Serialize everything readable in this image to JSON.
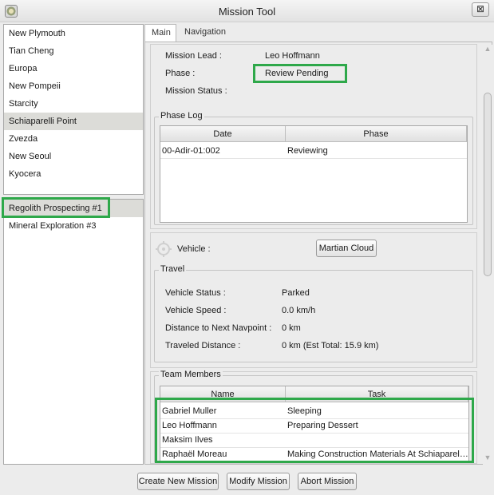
{
  "window": {
    "title": "Mission Tool",
    "close_glyph": "⊠"
  },
  "settlements": [
    "New Plymouth",
    "Tian Cheng",
    "Europa",
    "New Pompeii",
    "Starcity",
    "Schiaparelli Point",
    "Zvezda",
    "New Seoul",
    "Kyocera"
  ],
  "settlements_selected": "Schiaparelli Point",
  "missions": [
    "Regolith Prospecting #1",
    "Mineral Exploration #3"
  ],
  "missions_selected": "Regolith Prospecting #1",
  "tabs": [
    "Main",
    "Navigation"
  ],
  "active_tab": "Main",
  "mission": {
    "lead_label": "Mission Lead :",
    "lead_value": "Leo Hoffmann",
    "phase_label": "Phase :",
    "phase_value": "Review Pending",
    "status_label": "Mission Status :",
    "status_value": ""
  },
  "phase_log": {
    "title": "Phase Log",
    "columns": [
      "Date",
      "Phase"
    ],
    "rows": [
      [
        "00-Adir-01:002",
        "Reviewing"
      ]
    ]
  },
  "vehicle": {
    "label": "Vehicle :",
    "button": "Martian Cloud",
    "icon": "crosshair-icon"
  },
  "travel": {
    "title": "Travel",
    "rows": [
      {
        "label": "Vehicle Status :",
        "value": "Parked"
      },
      {
        "label": "Vehicle Speed :",
        "value": "0.0 km/h"
      },
      {
        "label": "Distance to Next Navpoint :",
        "value": "0 km"
      },
      {
        "label": "Traveled Distance :",
        "value": "0 km (Est Total: 15.9 km)"
      }
    ]
  },
  "team": {
    "title": "Team Members",
    "columns": [
      "Name",
      "Task"
    ],
    "rows": [
      [
        "Gabriel Muller",
        "Sleeping"
      ],
      [
        "Leo Hoffmann",
        "Preparing Dessert"
      ],
      [
        "Maksim Ilves",
        ""
      ],
      [
        "Raphaël Moreau",
        "Making Construction Materials At Schiaparelli Point"
      ]
    ]
  },
  "buttons": {
    "create": "Create New Mission",
    "modify": "Modify Mission",
    "abort": "Abort Mission"
  },
  "colors": {
    "highlight": "#2ea84a",
    "selected_row": "#dcdcd8"
  }
}
